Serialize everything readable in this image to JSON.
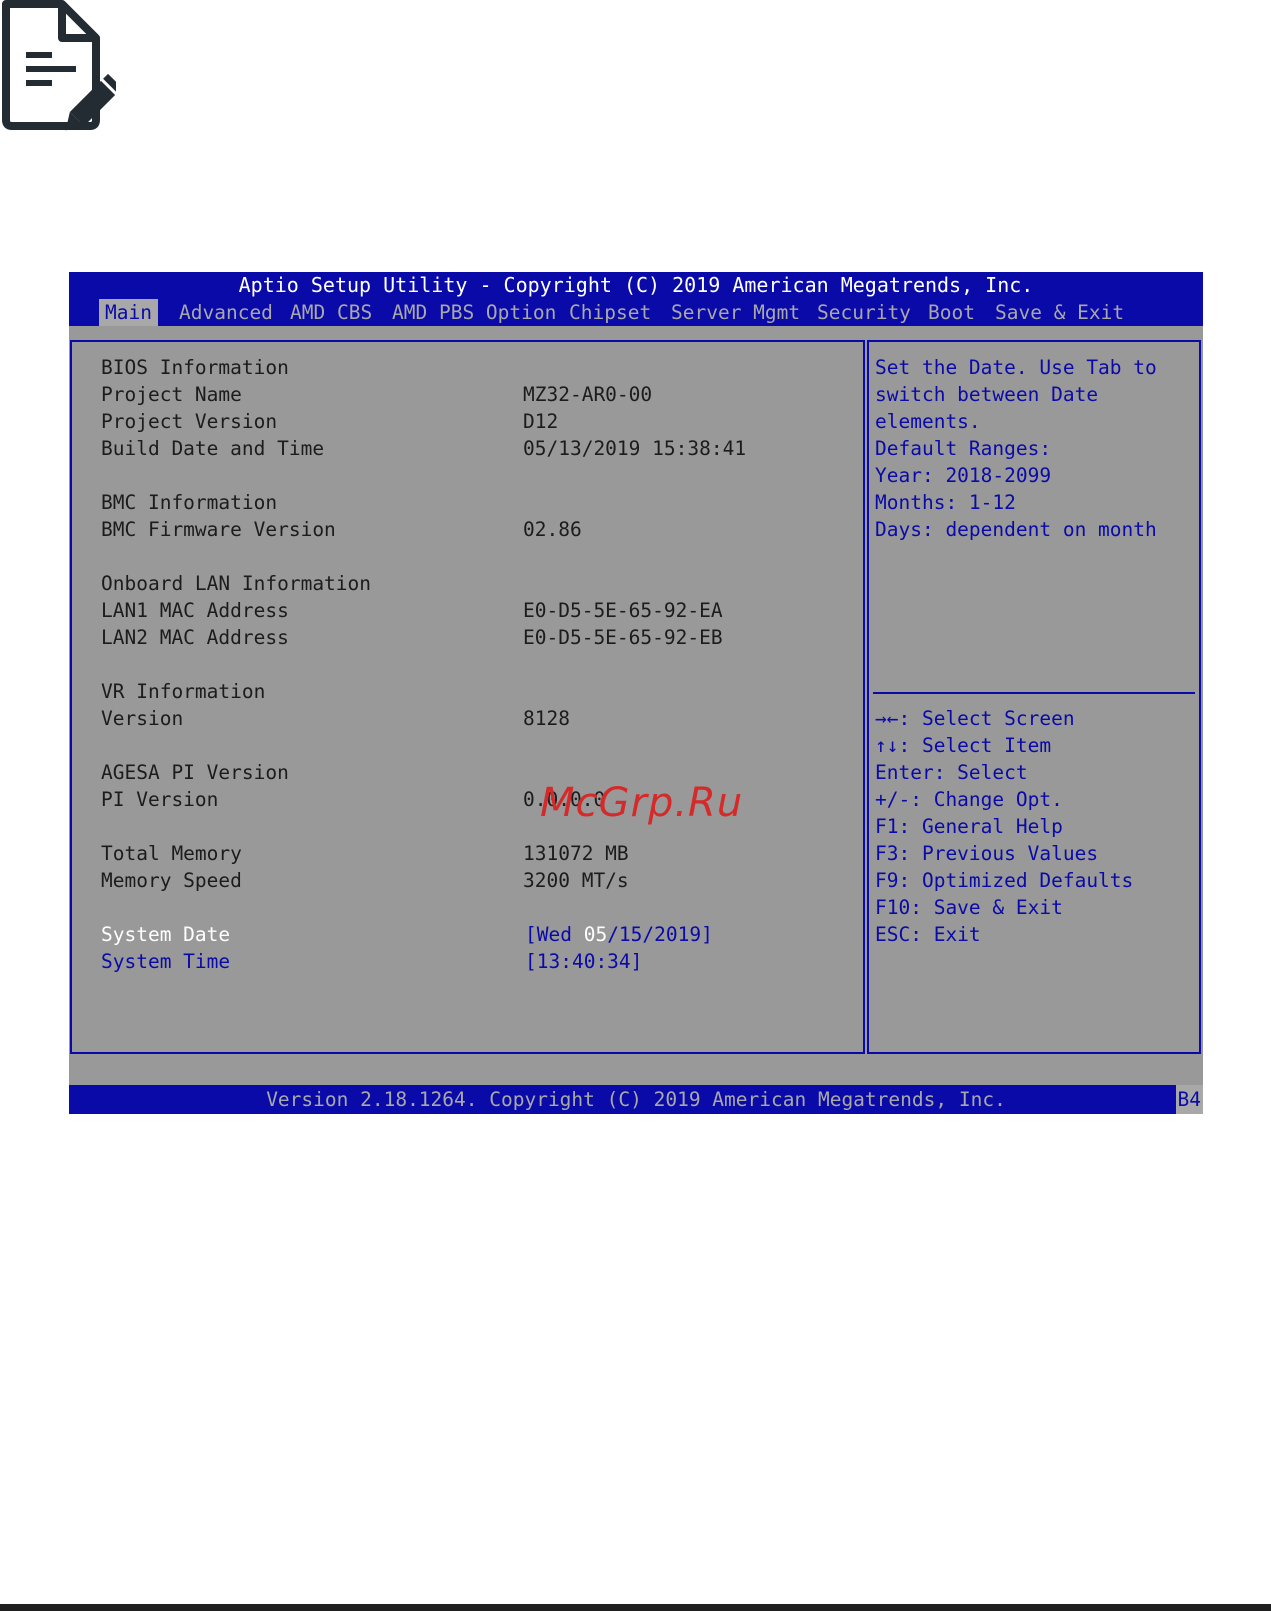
{
  "header": {
    "title": "Aptio Setup Utility - Copyright (C) 2019 American Megatrends, Inc."
  },
  "menu": {
    "tabs": [
      {
        "label": "Main",
        "active": true
      },
      {
        "label": "Advanced"
      },
      {
        "label": "AMD CBS"
      },
      {
        "label": "AMD PBS Option"
      },
      {
        "label": "Chipset"
      },
      {
        "label": "Server Mgmt"
      },
      {
        "label": "Security"
      },
      {
        "label": "Boot"
      },
      {
        "label": "Save & Exit"
      }
    ]
  },
  "main": {
    "bios": {
      "heading": "BIOS Information",
      "project_name_label": "Project Name",
      "project_name_value": "MZ32-AR0-00",
      "project_version_label": "Project Version",
      "project_version_value": "D12",
      "build_label": "Build Date and Time",
      "build_value": "05/13/2019 15:38:41"
    },
    "bmc": {
      "heading": "BMC Information",
      "fw_label": "BMC Firmware Version",
      "fw_value": "02.86"
    },
    "lan": {
      "heading": "Onboard LAN Information",
      "lan1_label": "LAN1 MAC Address",
      "lan1_value": "E0-D5-5E-65-92-EA",
      "lan2_label": "LAN2 MAC Address",
      "lan2_value": "E0-D5-5E-65-92-EB"
    },
    "vr": {
      "heading": "VR Information",
      "version_label": "Version",
      "version_value": "8128"
    },
    "agesa": {
      "heading": "AGESA PI Version",
      "pi_label": "PI Version",
      "pi_value": "0.0.0.0"
    },
    "memory": {
      "total_label": "Total Memory",
      "total_value": "131072 MB",
      "speed_label": "Memory Speed",
      "speed_value": "3200 MT/s"
    },
    "system_date": {
      "label": "System Date",
      "open": "[Wed ",
      "selected": "05",
      "rest": "/15/2019]"
    },
    "system_time": {
      "label": "System Time",
      "value": "[13:40:34]"
    }
  },
  "help": {
    "description": [
      "Set the Date. Use Tab to",
      "switch between Date",
      "elements.",
      "Default Ranges:",
      "Year: 2018-2099",
      "Months: 1-12",
      "Days: dependent on month"
    ],
    "keys": [
      "→←: Select Screen",
      "↑↓: Select Item",
      "Enter: Select",
      "+/-: Change Opt.",
      "F1: General Help",
      "F3: Previous Values",
      "F9: Optimized Defaults",
      "F10: Save & Exit",
      "ESC: Exit"
    ]
  },
  "footer": {
    "text": "Version 2.18.1264. Copyright (C) 2019 American Megatrends, Inc.",
    "code": "B4"
  },
  "watermark": "McGrp.Ru",
  "icons": {
    "note": "note-edit-icon"
  },
  "colors": {
    "bios_blue": "#0a0aa8",
    "bios_gray": "#999999",
    "tab_gray": "#a8a8a8",
    "watermark_red": "#d42a2a"
  }
}
